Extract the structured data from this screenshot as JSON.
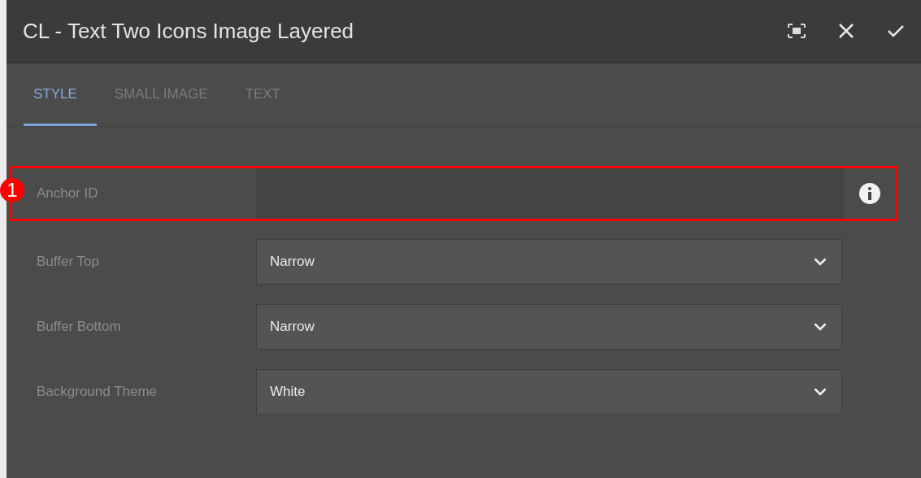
{
  "dialog": {
    "title": "CL - Text Two Icons Image Layered"
  },
  "tabs": [
    {
      "label": "STYLE",
      "selected": true
    },
    {
      "label": "SMALL IMAGE",
      "selected": false
    },
    {
      "label": "TEXT",
      "selected": false
    }
  ],
  "fields": [
    {
      "kind": "text",
      "label": "Anchor ID",
      "info": true,
      "callout": "1"
    },
    {
      "kind": "select",
      "label": "Buffer Top",
      "value": "Narrow"
    },
    {
      "kind": "select",
      "label": "Buffer Bottom",
      "value": "Narrow"
    },
    {
      "kind": "select",
      "label": "Background Theme",
      "value": "White"
    }
  ]
}
